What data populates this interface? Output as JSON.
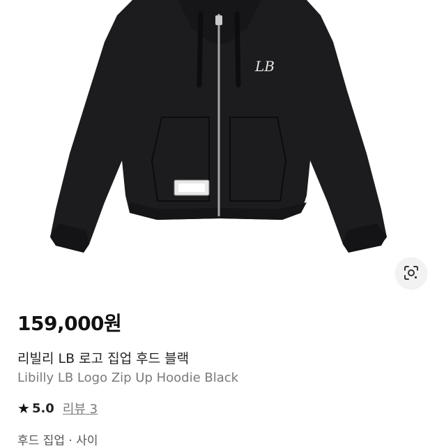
{
  "product": {
    "price": "159,000원",
    "title_ko": "리빌리 LB 로고 집업 후드 블랙",
    "title_en": "Libilly LB Logo Zip Up Hoodie Black",
    "rating_icon": "star-icon",
    "rating": "5.0",
    "reviews_label": "리뷰 3",
    "options_partial": "후드 집업 · 사이"
  },
  "image": {
    "alt": "Libilly LB Logo Zip Up Hoodie Black",
    "logo_text": "LB",
    "garment_color": "#1c1c1e"
  },
  "actions": {
    "lens_icon": "visual-search-icon"
  }
}
